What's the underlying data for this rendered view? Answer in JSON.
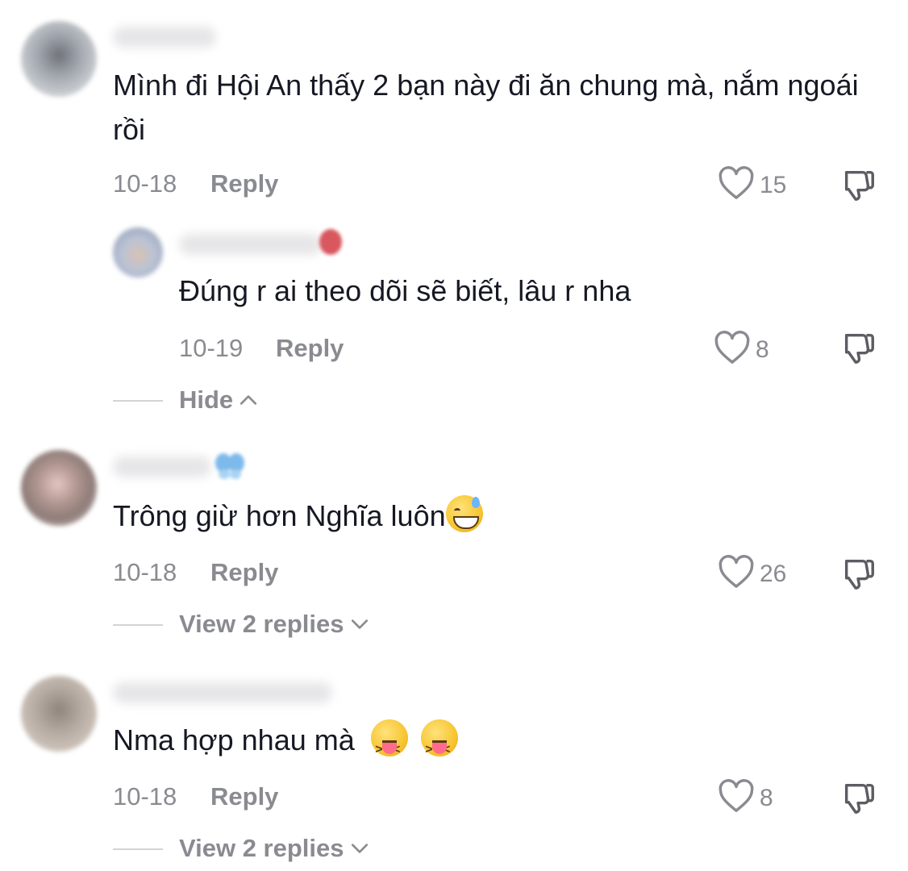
{
  "comments": [
    {
      "text": "Mình đi Hội An thấy 2 bạn này đi ăn chung mà, nắm ngoái rồi",
      "date": "10-18",
      "reply_label": "Reply",
      "likes": "15",
      "avatar_colors": [
        "#b7bcc4",
        "#6f7379",
        "#c9cdd1"
      ],
      "replies": [
        {
          "text": "Đúng r ai theo dõi sẽ biết, lâu r nha",
          "date": "10-19",
          "reply_label": "Reply",
          "likes": "8",
          "avatar_colors": [
            "#b9c3d6",
            "#d8c2b4",
            "#8a94ae"
          ]
        }
      ],
      "toggle_label": "Hide"
    },
    {
      "text": "Trông giừ hơn Nghĩa luôn",
      "date": "10-18",
      "reply_label": "Reply",
      "likes": "26",
      "avatar_colors": [
        "#e4c6c2",
        "#8f7d79",
        "#d6d0cf"
      ],
      "toggle_label": "View 2 replies"
    },
    {
      "text": "Nma hợp nhau mà",
      "date": "10-18",
      "reply_label": "Reply",
      "likes": "8",
      "avatar_colors": [
        "#cbc1b8",
        "#8f857c",
        "#b4aaa1"
      ],
      "toggle_label": "View 2 replies"
    }
  ],
  "colors": {
    "text": "#161823",
    "meta": "#8a8b91",
    "divider": "#d4d4d6",
    "blur_name": "#e6e6e8"
  },
  "icons": [
    "heart-outline-icon",
    "thumbs-down-icon",
    "chevron-up-icon",
    "chevron-down-icon",
    "grinning-sweat-emoji",
    "squinting-tongue-emoji",
    "butterfly-emoji",
    "strawberry-emoji"
  ]
}
